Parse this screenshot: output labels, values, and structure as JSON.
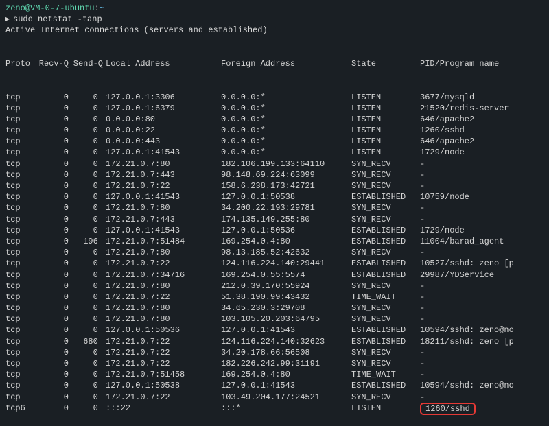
{
  "prompt": {
    "userhost": "zeno@VM-0-7-ubuntu",
    "sep": ":",
    "path": "~",
    "symbol": "▸",
    "command": "sudo netstat -tanp"
  },
  "title_line": "Active Internet connections (servers and established)",
  "headers": {
    "proto": "Proto",
    "recvq": "Recv-Q",
    "sendq": "Send-Q",
    "local": "Local Address",
    "foreign": "Foreign Address",
    "state": "State",
    "pid": "PID/Program name"
  },
  "rows": [
    {
      "proto": "tcp",
      "recvq": "0",
      "sendq": "0",
      "local": "127.0.0.1:3306",
      "foreign": "0.0.0.0:*",
      "state": "LISTEN",
      "pid": "3677/mysqld"
    },
    {
      "proto": "tcp",
      "recvq": "0",
      "sendq": "0",
      "local": "127.0.0.1:6379",
      "foreign": "0.0.0.0:*",
      "state": "LISTEN",
      "pid": "21520/redis-server"
    },
    {
      "proto": "tcp",
      "recvq": "0",
      "sendq": "0",
      "local": "0.0.0.0:80",
      "foreign": "0.0.0.0:*",
      "state": "LISTEN",
      "pid": "646/apache2"
    },
    {
      "proto": "tcp",
      "recvq": "0",
      "sendq": "0",
      "local": "0.0.0.0:22",
      "foreign": "0.0.0.0:*",
      "state": "LISTEN",
      "pid": "1260/sshd"
    },
    {
      "proto": "tcp",
      "recvq": "0",
      "sendq": "0",
      "local": "0.0.0.0:443",
      "foreign": "0.0.0.0:*",
      "state": "LISTEN",
      "pid": "646/apache2"
    },
    {
      "proto": "tcp",
      "recvq": "0",
      "sendq": "0",
      "local": "127.0.0.1:41543",
      "foreign": "0.0.0.0:*",
      "state": "LISTEN",
      "pid": "1729/node"
    },
    {
      "proto": "tcp",
      "recvq": "0",
      "sendq": "0",
      "local": "172.21.0.7:80",
      "foreign": "182.106.199.133:64110",
      "state": "SYN_RECV",
      "pid": "-"
    },
    {
      "proto": "tcp",
      "recvq": "0",
      "sendq": "0",
      "local": "172.21.0.7:443",
      "foreign": "98.148.69.224:63099",
      "state": "SYN_RECV",
      "pid": "-"
    },
    {
      "proto": "tcp",
      "recvq": "0",
      "sendq": "0",
      "local": "172.21.0.7:22",
      "foreign": "158.6.238.173:42721",
      "state": "SYN_RECV",
      "pid": "-"
    },
    {
      "proto": "tcp",
      "recvq": "0",
      "sendq": "0",
      "local": "127.0.0.1:41543",
      "foreign": "127.0.0.1:50538",
      "state": "ESTABLISHED",
      "pid": "10759/node"
    },
    {
      "proto": "tcp",
      "recvq": "0",
      "sendq": "0",
      "local": "172.21.0.7:80",
      "foreign": "34.200.22.193:29781",
      "state": "SYN_RECV",
      "pid": "-"
    },
    {
      "proto": "tcp",
      "recvq": "0",
      "sendq": "0",
      "local": "172.21.0.7:443",
      "foreign": "174.135.149.255:80",
      "state": "SYN_RECV",
      "pid": "-"
    },
    {
      "proto": "tcp",
      "recvq": "0",
      "sendq": "0",
      "local": "127.0.0.1:41543",
      "foreign": "127.0.0.1:50536",
      "state": "ESTABLISHED",
      "pid": "1729/node"
    },
    {
      "proto": "tcp",
      "recvq": "0",
      "sendq": "196",
      "local": "172.21.0.7:51484",
      "foreign": "169.254.0.4:80",
      "state": "ESTABLISHED",
      "pid": "11004/barad_agent"
    },
    {
      "proto": "tcp",
      "recvq": "0",
      "sendq": "0",
      "local": "172.21.0.7:80",
      "foreign": "98.13.185.52:42632",
      "state": "SYN_RECV",
      "pid": "-"
    },
    {
      "proto": "tcp",
      "recvq": "0",
      "sendq": "0",
      "local": "172.21.0.7:22",
      "foreign": "124.116.224.140:29441",
      "state": "ESTABLISHED",
      "pid": "10527/sshd: zeno [p"
    },
    {
      "proto": "tcp",
      "recvq": "0",
      "sendq": "0",
      "local": "172.21.0.7:34716",
      "foreign": "169.254.0.55:5574",
      "state": "ESTABLISHED",
      "pid": "29987/YDService"
    },
    {
      "proto": "tcp",
      "recvq": "0",
      "sendq": "0",
      "local": "172.21.0.7:80",
      "foreign": "212.0.39.170:55924",
      "state": "SYN_RECV",
      "pid": "-"
    },
    {
      "proto": "tcp",
      "recvq": "0",
      "sendq": "0",
      "local": "172.21.0.7:22",
      "foreign": "51.38.190.99:43432",
      "state": "TIME_WAIT",
      "pid": "-"
    },
    {
      "proto": "tcp",
      "recvq": "0",
      "sendq": "0",
      "local": "172.21.0.7:80",
      "foreign": "34.65.230.3:29708",
      "state": "SYN_RECV",
      "pid": "-"
    },
    {
      "proto": "tcp",
      "recvq": "0",
      "sendq": "0",
      "local": "172.21.0.7:80",
      "foreign": "103.105.20.203:64795",
      "state": "SYN_RECV",
      "pid": "-"
    },
    {
      "proto": "tcp",
      "recvq": "0",
      "sendq": "0",
      "local": "127.0.0.1:50536",
      "foreign": "127.0.0.1:41543",
      "state": "ESTABLISHED",
      "pid": "10594/sshd: zeno@no"
    },
    {
      "proto": "tcp",
      "recvq": "0",
      "sendq": "680",
      "local": "172.21.0.7:22",
      "foreign": "124.116.224.140:32623",
      "state": "ESTABLISHED",
      "pid": "18211/sshd: zeno [p"
    },
    {
      "proto": "tcp",
      "recvq": "0",
      "sendq": "0",
      "local": "172.21.0.7:22",
      "foreign": "34.20.178.66:56508",
      "state": "SYN_RECV",
      "pid": "-"
    },
    {
      "proto": "tcp",
      "recvq": "0",
      "sendq": "0",
      "local": "172.21.0.7:22",
      "foreign": "182.226.242.99:31191",
      "state": "SYN_RECV",
      "pid": "-"
    },
    {
      "proto": "tcp",
      "recvq": "0",
      "sendq": "0",
      "local": "172.21.0.7:51458",
      "foreign": "169.254.0.4:80",
      "state": "TIME_WAIT",
      "pid": "-"
    },
    {
      "proto": "tcp",
      "recvq": "0",
      "sendq": "0",
      "local": "127.0.0.1:50538",
      "foreign": "127.0.0.1:41543",
      "state": "ESTABLISHED",
      "pid": "10594/sshd: zeno@no"
    },
    {
      "proto": "tcp",
      "recvq": "0",
      "sendq": "0",
      "local": "172.21.0.7:22",
      "foreign": "103.49.204.177:24521",
      "state": "SYN_RECV",
      "pid": "-"
    },
    {
      "proto": "tcp6",
      "recvq": "0",
      "sendq": "0",
      "local": ":::22",
      "foreign": ":::*",
      "state": "LISTEN",
      "pid": "1260/sshd",
      "highlight": true
    }
  ]
}
